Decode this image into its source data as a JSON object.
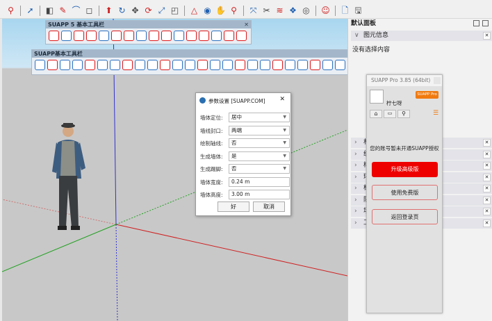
{
  "main_toolbar": {
    "icons": [
      "zoom-icon",
      "select-icon",
      "eraser-icon",
      "pencil-icon",
      "arc-icon",
      "rectangle-icon",
      "pushpull-icon",
      "followme-icon",
      "move-icon",
      "rotate-icon",
      "scale-icon",
      "offset-icon",
      "tape-icon",
      "protractor-icon",
      "orbit-icon",
      "pan-icon",
      "search-icon",
      "zoom-extents-icon",
      "section-icon",
      "layers-icon",
      "styles-icon",
      "account-icon",
      "new-file-icon",
      "save-icon"
    ]
  },
  "suapp5_toolbar": {
    "title": "SUAPP 5 基本工具栏",
    "close": "✕"
  },
  "suapp_toolbar": {
    "title": "SUAPP基本工具栏",
    "close": "✕"
  },
  "tray": {
    "title": "默认面板",
    "entity_info": "图元信息",
    "no_selection": "没有选择内容",
    "items": [
      "材料",
      "组件",
      "样式",
      "环境",
      "标记",
      "阴影",
      "场景",
      "工具向导"
    ],
    "close": "✕"
  },
  "suapp_panel": {
    "title": "SUAPP Pro 3.85 (64bit)",
    "badge": "SUAPP Pro",
    "username": "柠七呀",
    "message": "您的账号暂未开通SUAPP授权",
    "upgrade": "升级高级版",
    "free": "使用免费版",
    "back": "返回登录页",
    "accent": "#ee0000"
  },
  "dialog": {
    "title": "参数设置 [SUAPP.COM]",
    "close": "✕",
    "fields": [
      {
        "label": "墙体定位:",
        "value": "居中",
        "select": true
      },
      {
        "label": "墙线封口:",
        "value": "两端",
        "select": true
      },
      {
        "label": "绘制轴线:",
        "value": "否",
        "select": true
      },
      {
        "label": "生成墙体:",
        "value": "是",
        "select": true
      },
      {
        "label": "生成踢脚:",
        "value": "否",
        "select": true
      },
      {
        "label": "墙体宽度:",
        "value": "0.24 m",
        "select": false
      },
      {
        "label": "墙体高度:",
        "value": "3.00 m",
        "select": false
      }
    ],
    "ok": "好",
    "cancel": "取消"
  }
}
